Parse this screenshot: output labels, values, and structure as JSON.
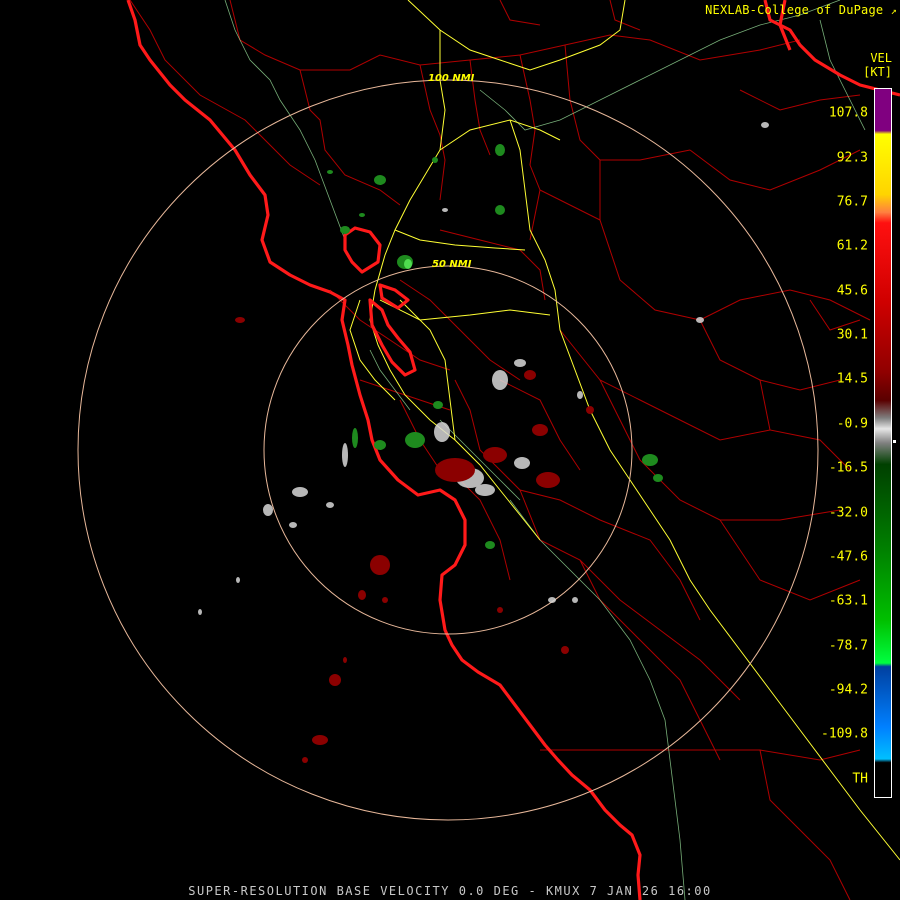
{
  "credit": "NEXLAB-College of DuPage",
  "credit_arrow": "↗",
  "product": "SUPER-RESOLUTION BASE VELOCITY 0.0 DEG - KMUX 7 JAN 26 16:00",
  "legend": {
    "product_code": "VEL",
    "unit": "[KT]",
    "values": [
      "107.8",
      "92.3",
      "76.7",
      "61.2",
      "45.6",
      "30.1",
      "14.5",
      "-0.9",
      "-16.5",
      "-32.0",
      "-47.6",
      "-63.1",
      "-78.7",
      "-94.2",
      "-109.8",
      "TH"
    ]
  },
  "range_rings": [
    {
      "label": "100 NMI"
    },
    {
      "label": "50 NMI"
    }
  ],
  "colors": {
    "ring": "#e8b89a",
    "coast": "#ff1a1a",
    "county": "#c00000",
    "highway": "#ffff33",
    "river": "#9fe8a0",
    "text": "#ffff00",
    "footer": "#c8c8c8"
  }
}
